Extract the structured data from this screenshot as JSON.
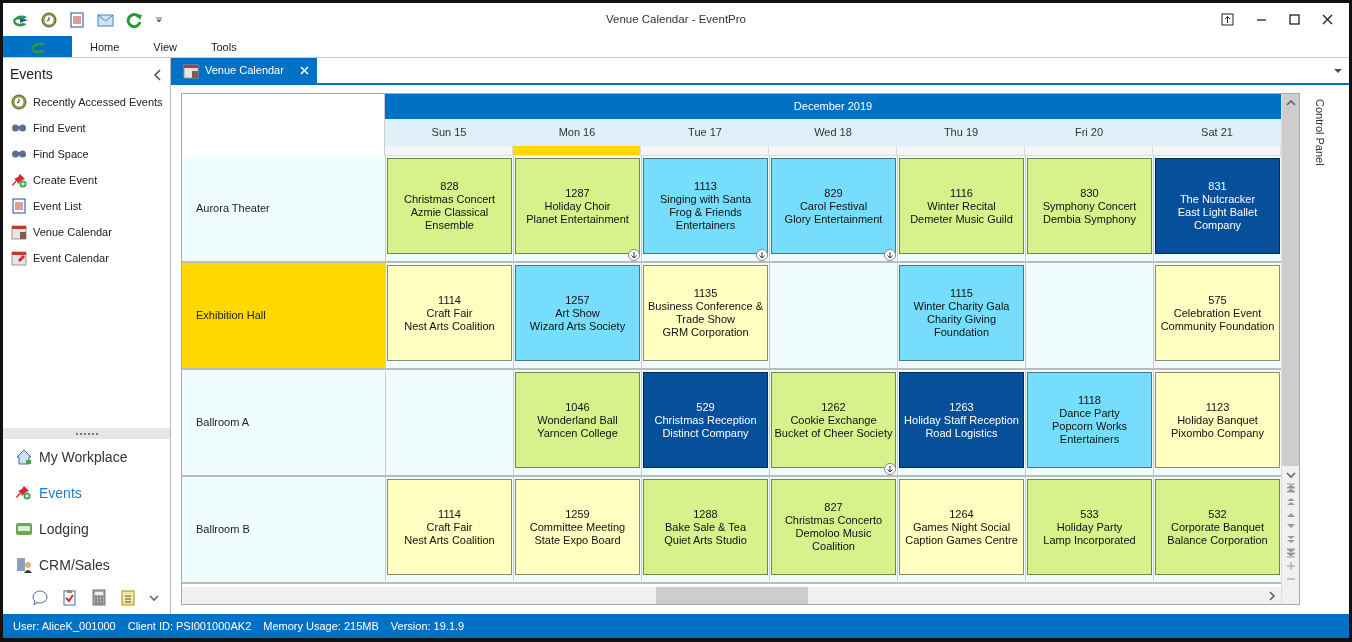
{
  "window": {
    "title": "Venue Calendar - EventPro"
  },
  "menu": [
    {
      "label": "Home"
    },
    {
      "label": "View"
    },
    {
      "label": "Tools"
    }
  ],
  "sidebar": {
    "title": "Events",
    "items": [
      {
        "label": "Recently Accessed Events"
      },
      {
        "label": "Find Event"
      },
      {
        "label": "Find Space"
      },
      {
        "label": "Create Event"
      },
      {
        "label": "Event List"
      },
      {
        "label": "Venue Calendar"
      },
      {
        "label": "Event Calendar"
      }
    ],
    "nav": [
      {
        "label": "My Workplace",
        "selected": false
      },
      {
        "label": "Events",
        "selected": true
      },
      {
        "label": "Lodging",
        "selected": false
      },
      {
        "label": "CRM/Sales",
        "selected": false
      }
    ]
  },
  "document_tab": {
    "label": "Venue Calendar"
  },
  "calendar": {
    "month": "December 2019",
    "days": [
      {
        "label": "Sun 15",
        "selected": false
      },
      {
        "label": "Mon 16",
        "selected": true
      },
      {
        "label": "Tue 17",
        "selected": false
      },
      {
        "label": "Wed 18",
        "selected": false
      },
      {
        "label": "Thu 19",
        "selected": false
      },
      {
        "label": "Fri 20",
        "selected": false
      },
      {
        "label": "Sat 21",
        "selected": false
      }
    ],
    "venues": [
      {
        "name": "Aurora Theater",
        "selected": false,
        "cells": [
          {
            "kind": "event",
            "number": "828",
            "title": "Christmas Concert",
            "client": "Azmie Classical Ensemble",
            "color": "#d5f28b",
            "more": false
          },
          {
            "kind": "event",
            "number": "1287",
            "title": "Holiday Choir",
            "client": "Planet Entertainment",
            "color": "#d5f28b",
            "more": true
          },
          {
            "kind": "event",
            "number": "1113",
            "title": "Singing with Santa",
            "client": "Frog & Friends Entertainers",
            "color": "#76defc",
            "more": true
          },
          {
            "kind": "event",
            "number": "829",
            "title": "Carol Festival",
            "client": "Glory Entertainment",
            "color": "#76defc",
            "more": true
          },
          {
            "kind": "event",
            "number": "1116",
            "title": "Winter Recital",
            "client": "Demeter Music Guild",
            "color": "#d5f28b",
            "more": false
          },
          {
            "kind": "event",
            "number": "830",
            "title": "Symphony Concert",
            "client": "Dembia Symphony",
            "color": "#d5f28b",
            "more": false
          },
          {
            "kind": "event",
            "number": "831",
            "title": "The Nutcracker",
            "client": "East Light Ballet Company",
            "color": "#054f9b",
            "more": false
          }
        ]
      },
      {
        "name": "Exhibition Hall",
        "selected": true,
        "cells": [
          {
            "kind": "event",
            "number": "1114",
            "title": "Craft Fair",
            "client": "Nest Arts Coalition",
            "color": "#ffffc1",
            "more": false
          },
          {
            "kind": "event",
            "number": "1257",
            "title": "Art Show",
            "client": "Wizard Arts Society",
            "color": "#76defc",
            "more": false
          },
          {
            "kind": "event",
            "number": "1135",
            "title": "Business Conference & Trade Show",
            "client": "GRM Corporation",
            "color": "#ffffc1",
            "more": false
          },
          {
            "kind": "empty"
          },
          {
            "kind": "event",
            "number": "1115",
            "title": "Winter Charity Gala",
            "client": "Charity Giving Foundation",
            "color": "#76defc",
            "more": false
          },
          {
            "kind": "empty"
          },
          {
            "kind": "event",
            "number": "575",
            "title": "Celebration Event",
            "client": "Community Foundation",
            "color": "#ffffc1",
            "more": false
          }
        ]
      },
      {
        "name": "Ballroom A",
        "selected": false,
        "cells": [
          {
            "kind": "empty"
          },
          {
            "kind": "event",
            "number": "1046",
            "title": "Wonderland Ball",
            "client": "Yarncen College",
            "color": "#d5f28b",
            "more": false
          },
          {
            "kind": "event",
            "number": "529",
            "title": "Christmas Reception",
            "client": "Distinct Company",
            "color": "#054f9b",
            "more": false
          },
          {
            "kind": "event",
            "number": "1262",
            "title": "Cookie Exchange",
            "client": "Bucket of Cheer Society",
            "color": "#d5f28b",
            "more": true
          },
          {
            "kind": "event",
            "number": "1263",
            "title": "Holiday Staff Reception",
            "client": "Road Logistics",
            "color": "#054f9b",
            "more": false
          },
          {
            "kind": "event",
            "number": "1118",
            "title": "Dance Party",
            "client": "Popcorn Works Entertainers",
            "color": "#76defc",
            "more": false
          },
          {
            "kind": "event",
            "number": "1123",
            "title": "Holiday Banquet",
            "client": "Pixombo Company",
            "color": "#ffffc1",
            "more": false
          }
        ]
      },
      {
        "name": "Ballroom B",
        "selected": false,
        "cells": [
          {
            "kind": "event",
            "number": "1114",
            "title": "Craft Fair",
            "client": "Nest Arts Coalition",
            "color": "#ffffc1",
            "more": false
          },
          {
            "kind": "event",
            "number": "1259",
            "title": "Committee Meeting",
            "client": "State Expo Board",
            "color": "#ffffc1",
            "more": false
          },
          {
            "kind": "event",
            "number": "1288",
            "title": "Bake Sale & Tea",
            "client": "Quiet Arts Studio",
            "color": "#d5f28b",
            "more": false
          },
          {
            "kind": "event",
            "number": "827",
            "title": "Christmas Concerto",
            "client": "Demoloo Music Coalition",
            "color": "#d5f28b",
            "more": false
          },
          {
            "kind": "event",
            "number": "1264",
            "title": "Games Night Social",
            "client": "Caption Games Centre",
            "color": "#ffffc1",
            "more": false
          },
          {
            "kind": "event",
            "number": "533",
            "title": "Holiday Party",
            "client": "Lamp Incorporated",
            "color": "#d5f28b",
            "more": false
          },
          {
            "kind": "event",
            "number": "532",
            "title": "Corporate Banquet",
            "client": "Balance Corporation",
            "color": "#d5f28b",
            "more": false
          }
        ]
      }
    ]
  },
  "control_panel": {
    "label": "Control Panel"
  },
  "status_bar": [
    {
      "text": "User: AliceK_001000"
    },
    {
      "text": "Client ID: PSI001000AK2"
    },
    {
      "text": "Memory Usage: 215MB"
    },
    {
      "text": "Version: 19.1.9"
    }
  ]
}
